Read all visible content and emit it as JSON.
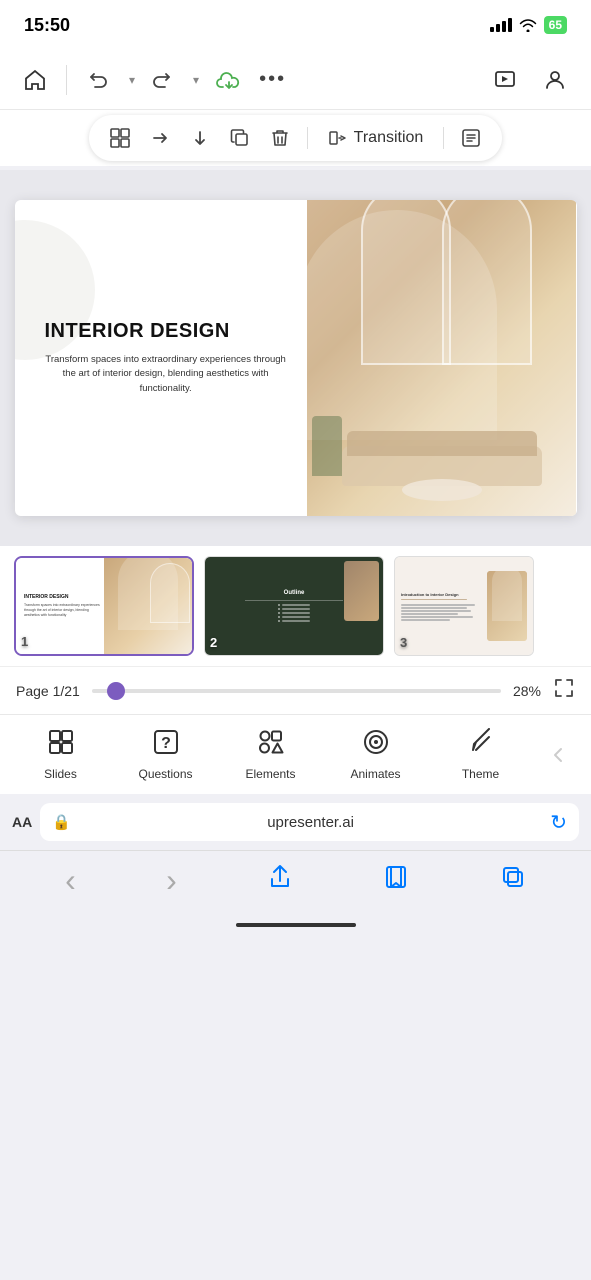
{
  "statusBar": {
    "time": "15:50",
    "battery": "65"
  },
  "toolbar1": {
    "home": "⌂",
    "undo": "↩",
    "redo": "↪",
    "more": "•••",
    "play": "▶",
    "profile": "👤"
  },
  "toolbar2": {
    "layout": "⊞",
    "arrow_right": "→",
    "arrow_down": "↓",
    "copy": "⧉",
    "delete": "🗑",
    "transition_icon": "⤞",
    "transition_label": "Transition",
    "notes": "≡"
  },
  "slide": {
    "title": "INTERIOR DESIGN",
    "body": "Transform spaces into extraordinary\nexperiences through the art of\ninterior design, blending aesthetics\nwith functionality."
  },
  "slideStrip": {
    "slides": [
      {
        "number": "1",
        "type": "main"
      },
      {
        "number": "2",
        "type": "dark"
      },
      {
        "number": "3",
        "type": "light"
      }
    ]
  },
  "pageInfo": {
    "page": "Page 1/21",
    "zoom": "28%",
    "sliderPercent": 4.76
  },
  "bottomNav": {
    "items": [
      {
        "icon": "⊞",
        "label": "Slides"
      },
      {
        "icon": "?",
        "label": "Questions"
      },
      {
        "icon": "⁂",
        "label": "Elements"
      },
      {
        "icon": "◎",
        "label": "Animates"
      },
      {
        "icon": "✎",
        "label": "Theme"
      }
    ]
  },
  "browserBar": {
    "aa": "AA",
    "lock_icon": "🔒",
    "url": "upresenter.ai",
    "refresh": "↻"
  },
  "safariBottom": {
    "back": "‹",
    "forward": "›",
    "share": "⬆",
    "bookmarks": "⊡",
    "tabs": "⧉"
  }
}
